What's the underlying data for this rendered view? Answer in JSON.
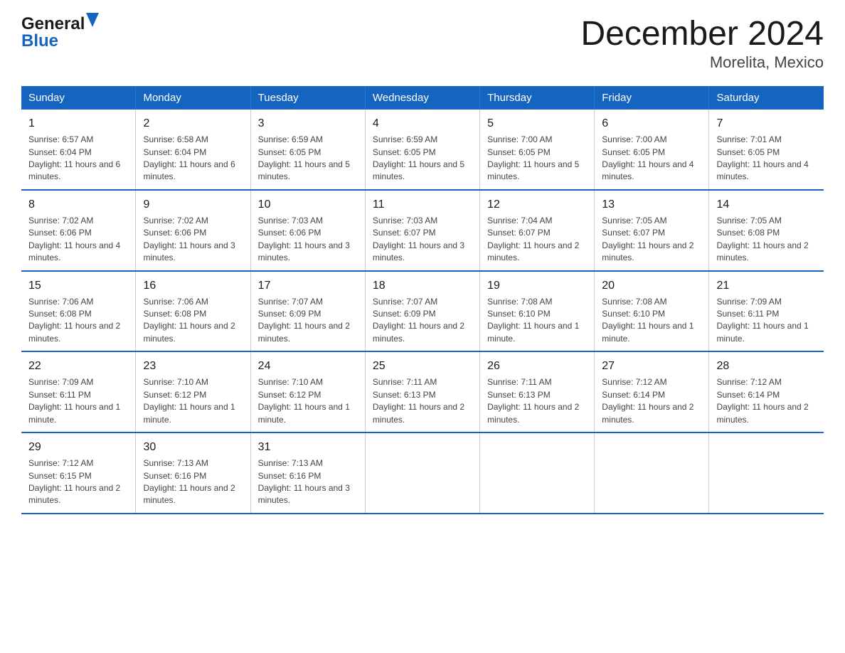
{
  "header": {
    "logo_general": "General",
    "logo_blue": "Blue",
    "title": "December 2024",
    "subtitle": "Morelita, Mexico"
  },
  "weekdays": [
    "Sunday",
    "Monday",
    "Tuesday",
    "Wednesday",
    "Thursday",
    "Friday",
    "Saturday"
  ],
  "weeks": [
    [
      {
        "day": "1",
        "sunrise": "Sunrise: 6:57 AM",
        "sunset": "Sunset: 6:04 PM",
        "daylight": "Daylight: 11 hours and 6 minutes."
      },
      {
        "day": "2",
        "sunrise": "Sunrise: 6:58 AM",
        "sunset": "Sunset: 6:04 PM",
        "daylight": "Daylight: 11 hours and 6 minutes."
      },
      {
        "day": "3",
        "sunrise": "Sunrise: 6:59 AM",
        "sunset": "Sunset: 6:05 PM",
        "daylight": "Daylight: 11 hours and 5 minutes."
      },
      {
        "day": "4",
        "sunrise": "Sunrise: 6:59 AM",
        "sunset": "Sunset: 6:05 PM",
        "daylight": "Daylight: 11 hours and 5 minutes."
      },
      {
        "day": "5",
        "sunrise": "Sunrise: 7:00 AM",
        "sunset": "Sunset: 6:05 PM",
        "daylight": "Daylight: 11 hours and 5 minutes."
      },
      {
        "day": "6",
        "sunrise": "Sunrise: 7:00 AM",
        "sunset": "Sunset: 6:05 PM",
        "daylight": "Daylight: 11 hours and 4 minutes."
      },
      {
        "day": "7",
        "sunrise": "Sunrise: 7:01 AM",
        "sunset": "Sunset: 6:05 PM",
        "daylight": "Daylight: 11 hours and 4 minutes."
      }
    ],
    [
      {
        "day": "8",
        "sunrise": "Sunrise: 7:02 AM",
        "sunset": "Sunset: 6:06 PM",
        "daylight": "Daylight: 11 hours and 4 minutes."
      },
      {
        "day": "9",
        "sunrise": "Sunrise: 7:02 AM",
        "sunset": "Sunset: 6:06 PM",
        "daylight": "Daylight: 11 hours and 3 minutes."
      },
      {
        "day": "10",
        "sunrise": "Sunrise: 7:03 AM",
        "sunset": "Sunset: 6:06 PM",
        "daylight": "Daylight: 11 hours and 3 minutes."
      },
      {
        "day": "11",
        "sunrise": "Sunrise: 7:03 AM",
        "sunset": "Sunset: 6:07 PM",
        "daylight": "Daylight: 11 hours and 3 minutes."
      },
      {
        "day": "12",
        "sunrise": "Sunrise: 7:04 AM",
        "sunset": "Sunset: 6:07 PM",
        "daylight": "Daylight: 11 hours and 2 minutes."
      },
      {
        "day": "13",
        "sunrise": "Sunrise: 7:05 AM",
        "sunset": "Sunset: 6:07 PM",
        "daylight": "Daylight: 11 hours and 2 minutes."
      },
      {
        "day": "14",
        "sunrise": "Sunrise: 7:05 AM",
        "sunset": "Sunset: 6:08 PM",
        "daylight": "Daylight: 11 hours and 2 minutes."
      }
    ],
    [
      {
        "day": "15",
        "sunrise": "Sunrise: 7:06 AM",
        "sunset": "Sunset: 6:08 PM",
        "daylight": "Daylight: 11 hours and 2 minutes."
      },
      {
        "day": "16",
        "sunrise": "Sunrise: 7:06 AM",
        "sunset": "Sunset: 6:08 PM",
        "daylight": "Daylight: 11 hours and 2 minutes."
      },
      {
        "day": "17",
        "sunrise": "Sunrise: 7:07 AM",
        "sunset": "Sunset: 6:09 PM",
        "daylight": "Daylight: 11 hours and 2 minutes."
      },
      {
        "day": "18",
        "sunrise": "Sunrise: 7:07 AM",
        "sunset": "Sunset: 6:09 PM",
        "daylight": "Daylight: 11 hours and 2 minutes."
      },
      {
        "day": "19",
        "sunrise": "Sunrise: 7:08 AM",
        "sunset": "Sunset: 6:10 PM",
        "daylight": "Daylight: 11 hours and 1 minute."
      },
      {
        "day": "20",
        "sunrise": "Sunrise: 7:08 AM",
        "sunset": "Sunset: 6:10 PM",
        "daylight": "Daylight: 11 hours and 1 minute."
      },
      {
        "day": "21",
        "sunrise": "Sunrise: 7:09 AM",
        "sunset": "Sunset: 6:11 PM",
        "daylight": "Daylight: 11 hours and 1 minute."
      }
    ],
    [
      {
        "day": "22",
        "sunrise": "Sunrise: 7:09 AM",
        "sunset": "Sunset: 6:11 PM",
        "daylight": "Daylight: 11 hours and 1 minute."
      },
      {
        "day": "23",
        "sunrise": "Sunrise: 7:10 AM",
        "sunset": "Sunset: 6:12 PM",
        "daylight": "Daylight: 11 hours and 1 minute."
      },
      {
        "day": "24",
        "sunrise": "Sunrise: 7:10 AM",
        "sunset": "Sunset: 6:12 PM",
        "daylight": "Daylight: 11 hours and 1 minute."
      },
      {
        "day": "25",
        "sunrise": "Sunrise: 7:11 AM",
        "sunset": "Sunset: 6:13 PM",
        "daylight": "Daylight: 11 hours and 2 minutes."
      },
      {
        "day": "26",
        "sunrise": "Sunrise: 7:11 AM",
        "sunset": "Sunset: 6:13 PM",
        "daylight": "Daylight: 11 hours and 2 minutes."
      },
      {
        "day": "27",
        "sunrise": "Sunrise: 7:12 AM",
        "sunset": "Sunset: 6:14 PM",
        "daylight": "Daylight: 11 hours and 2 minutes."
      },
      {
        "day": "28",
        "sunrise": "Sunrise: 7:12 AM",
        "sunset": "Sunset: 6:14 PM",
        "daylight": "Daylight: 11 hours and 2 minutes."
      }
    ],
    [
      {
        "day": "29",
        "sunrise": "Sunrise: 7:12 AM",
        "sunset": "Sunset: 6:15 PM",
        "daylight": "Daylight: 11 hours and 2 minutes."
      },
      {
        "day": "30",
        "sunrise": "Sunrise: 7:13 AM",
        "sunset": "Sunset: 6:16 PM",
        "daylight": "Daylight: 11 hours and 2 minutes."
      },
      {
        "day": "31",
        "sunrise": "Sunrise: 7:13 AM",
        "sunset": "Sunset: 6:16 PM",
        "daylight": "Daylight: 11 hours and 3 minutes."
      },
      null,
      null,
      null,
      null
    ]
  ]
}
